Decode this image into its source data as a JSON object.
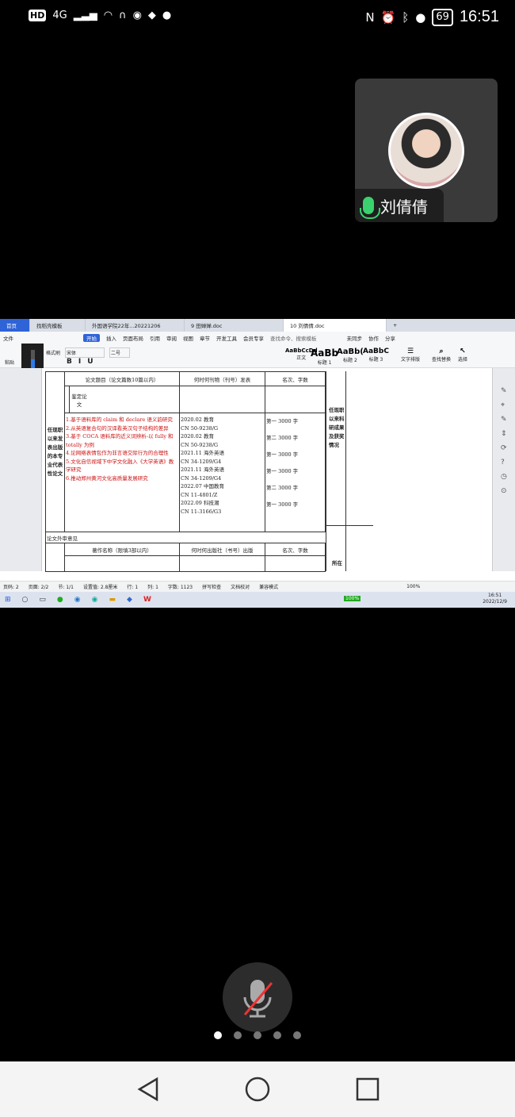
{
  "statusbar": {
    "hd": "HD",
    "net": "4G",
    "battery": "69",
    "time": "16:51"
  },
  "participant": {
    "name": "刘倩倩"
  },
  "doc_app": {
    "tabs": [
      "首页",
      "找稻壳模板",
      "外国语学院22年...20221206",
      "9 田婵婵.doc",
      "10 刘倩倩.doc"
    ],
    "ribbon_tabs": [
      "文件",
      "开始",
      "插入",
      "页面布局",
      "引用",
      "审阅",
      "视图",
      "章节",
      "开发工具",
      "会员专享"
    ],
    "search_hint": "查找命令、搜索模板",
    "sync": "未同步",
    "collab": "协作",
    "share": "分享",
    "font": "宋体",
    "size": "二号",
    "styles": [
      {
        "preview": "AaBbCcDd",
        "label": "正文"
      },
      {
        "preview": "AaBb",
        "label": "标题 1"
      },
      {
        "preview": "AaBb(",
        "label": "标题 2"
      },
      {
        "preview": "AaBbC",
        "label": "标题 3"
      }
    ],
    "tools": [
      "文字排版",
      "查找替换",
      "选择"
    ],
    "paste": "粘贴",
    "format_painter": "格式刷",
    "volume": "42"
  },
  "table": {
    "header": [
      "论文题目（论文篇数10篇以内）",
      "何时何刊物（刊号）发表",
      "名次、字数"
    ],
    "appraisal": "鉴定论文",
    "left_label": "任现职以来发表出版的本专业代表性论文",
    "titles": [
      "1.基于语料库的 claim 和 declare 语义韵研究",
      "2.从英语复合句的汉译看英汉句子结构的差异",
      "3.基于 COCA 语料库的近义词辨析-以 fully 和 totally 为例",
      "4.论网络表情包作为非言语交际行为的合理性",
      "5.文化自信视域下中学文化融入《大学英语》教学研究",
      "6.推动郑州黄河文化高质量发展研究"
    ],
    "journals": [
      "2020.02 教育",
      "CN 50-9238/G",
      "2020.02 教育",
      "CN 50-9238/G",
      "2021.11 海外英语",
      "CN 34-1209/G4",
      "2021.11 海外英语",
      "CN 34-1209/G4",
      "2022.07 中国教育",
      "CN 11-4801/Z",
      "2022.09 科技潮",
      "CN 11-3166/G3"
    ],
    "ranks": [
      "第一  3000 字",
      "第二  3000 字",
      "第一  3000 字",
      "第一  3000 字",
      "第二  3000 字",
      "第一  3000 字"
    ],
    "outside_review": "论文外审意见",
    "books_header": [
      "著作名称（限填3部以内）",
      "何时何出版社（书号）出版",
      "名次、字数"
    ],
    "right_label": "任现职以来科研成果及获奖情况",
    "right_bottom": "所在"
  },
  "docstatus": [
    "页码: 2",
    "页面: 2/2",
    "节: 1/1",
    "设置值: 2.8厘米",
    "行: 1",
    "列: 1",
    "字数: 1123",
    "拼写检查",
    "文档校对",
    "兼容模式",
    "100%"
  ],
  "taskbar": {
    "time": "16:51",
    "date": "2022/12/9",
    "batt": "100%"
  }
}
